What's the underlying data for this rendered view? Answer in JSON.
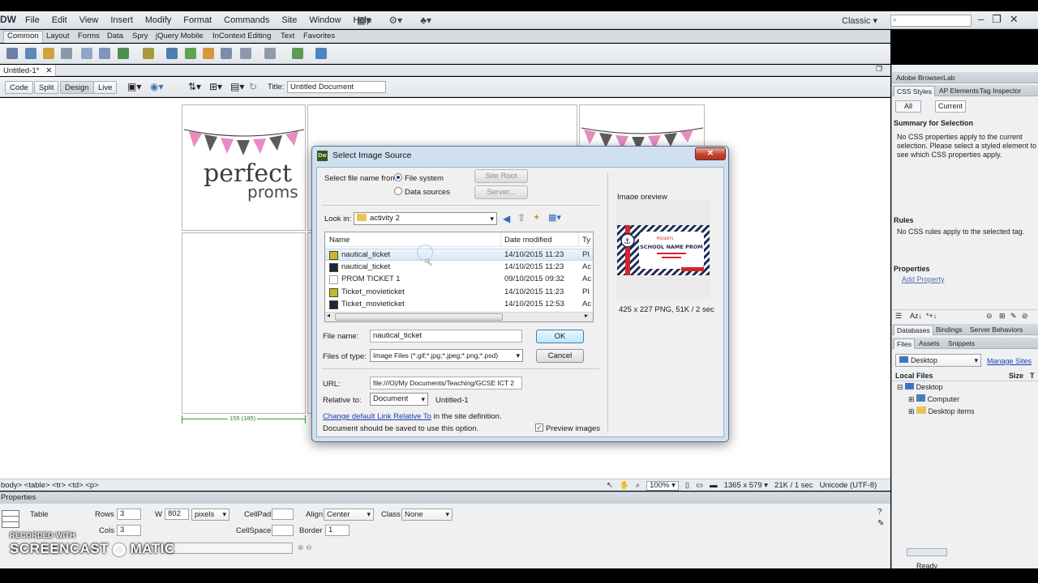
{
  "app": {
    "logo": "DW",
    "menu": [
      "File",
      "Edit",
      "View",
      "Insert",
      "Modify",
      "Format",
      "Commands",
      "Site",
      "Window",
      "Help"
    ],
    "workspace": "Classic"
  },
  "insert_tabs": [
    "Common",
    "Layout",
    "Forms",
    "Data",
    "Spry",
    "jQuery Mobile",
    "InContext Editing",
    "Text",
    "Favorites"
  ],
  "document": {
    "tab_title": "Untitled-1*",
    "view_buttons": [
      "Code",
      "Split",
      "Design",
      "Live"
    ],
    "active_view": "Design",
    "title_label": "Title:",
    "title_value": "Untitled Document",
    "logo_text_line1": "perfect",
    "logo_text_line2": "proms",
    "width_indicator": "155 (185)"
  },
  "status_bar": {
    "tags": "body> <table> <tr> <td> <p>",
    "zoom": "100%",
    "dimensions": "1365 x 579",
    "size_time": "21K / 1 sec",
    "encoding": "Unicode (UTF-8)"
  },
  "properties": {
    "header": "Properties",
    "element_label": "Table",
    "rows_label": "Rows",
    "rows_value": "3",
    "cols_label": "Cols",
    "cols_value": "3",
    "w_label": "W",
    "w_value": "802",
    "w_unit": "pixels",
    "cellpad_label": "CellPad",
    "cellpad_value": "",
    "cellspace_label": "CellSpace",
    "cellspace_value": "",
    "align_label": "Align",
    "align_value": "Center",
    "border_label": "Border",
    "border_value": "1",
    "class_label": "Class",
    "class_value": "None"
  },
  "watermark": {
    "line1": "RECORDED WITH",
    "line2": "SCREENCAST",
    "line3": "MATIC"
  },
  "right_panel": {
    "browserlab": "Adobe BrowserLab",
    "css_tabs": [
      "CSS Styles",
      "AP Elements",
      "Tag Inspector"
    ],
    "all_btn": "All",
    "current_btn": "Current",
    "summary_heading": "Summary for Selection",
    "summary_text": "No CSS properties apply to the current selection.  Please select a styled element to see which CSS properties apply.",
    "rules_heading": "Rules",
    "rules_text": "No CSS rules apply to the selected tag.",
    "properties_heading": "Properties",
    "add_property": "Add Property",
    "db_tabs": [
      "Databases",
      "Bindings",
      "Server Behaviors"
    ],
    "files_tabs": [
      "Files",
      "Assets",
      "Snippets"
    ],
    "site_select": "Desktop",
    "manage_sites": "Manage Sites",
    "local_files": "Local Files",
    "size_col": "Size",
    "type_col": "T",
    "tree": [
      "Desktop",
      "Computer",
      "Desktop items"
    ],
    "ready": "Ready"
  },
  "dialog": {
    "title": "Select Image Source",
    "select_from_label": "Select file name from:",
    "radio_file_system": "File system",
    "radio_data_sources": "Data sources",
    "site_root_btn": "Site Root",
    "server_btn": "Server...",
    "look_in_label": "Look in:",
    "look_in_value": "activity 2",
    "columns": [
      "Name",
      "Date modified",
      "Ty"
    ],
    "files": [
      {
        "name": "nautical_ticket",
        "date": "14/10/2015 11:23",
        "type": "PI",
        "icon": "png-file-icon",
        "selected": true
      },
      {
        "name": "nautical_ticket",
        "date": "14/10/2015 11:23",
        "type": "Ac",
        "icon": "ai-file-icon",
        "selected": false
      },
      {
        "name": "PROM TICKET 1",
        "date": "09/10/2015 09:32",
        "type": "Ac",
        "icon": "blank-file-icon",
        "selected": false
      },
      {
        "name": "Ticket_movieticket",
        "date": "14/10/2015 11:23",
        "type": "PI",
        "icon": "png-file-icon",
        "selected": false
      },
      {
        "name": "Ticket_movieticket",
        "date": "14/10/2015 12:53",
        "type": "Ac",
        "icon": "ai-file-icon",
        "selected": false
      }
    ],
    "file_name_label": "File name:",
    "file_name_value": "nautical_ticket",
    "files_of_type_label": "Files of type:",
    "files_of_type_value": "Image Files (*.gif;*.jpg;*.jpeg;*.png;*.psd)",
    "ok_btn": "OK",
    "cancel_btn": "Cancel",
    "url_label": "URL:",
    "url_value": "file:///O|/My Documents/Teaching/GCSE ICT 2",
    "relative_label": "Relative to:",
    "relative_value": "Document",
    "relative_file": "Untitled-1",
    "change_link": "Change default Link Relative To",
    "change_suffix": " in the site definition.",
    "save_note": "Document should be saved to use this option.",
    "preview_checkbox": "Preview images",
    "preview_checked": true,
    "preview_heading": "Image preview",
    "preview_info": "425 x 227 PNG, 51K / 2 sec",
    "ticket_line1": "SCHOOL NAME PROM",
    "ticket_small": "PRESENTS"
  },
  "colors": {
    "ticket_navy": "#1f2a55",
    "ticket_red": "#d4242b",
    "bunting_pink": "#e98bc0",
    "bunting_gray": "#5b5b5b"
  }
}
